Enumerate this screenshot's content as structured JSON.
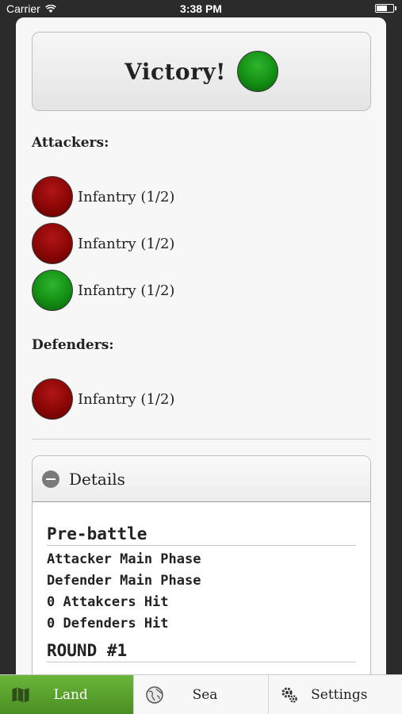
{
  "status_bar": {
    "carrier": "Carrier",
    "time": "3:38 PM"
  },
  "result": {
    "label": "Victory!",
    "indicator_color": "green"
  },
  "attackers": {
    "label": "Attackers:",
    "units": [
      {
        "name": "Infantry (1/2)",
        "status": "red"
      },
      {
        "name": "Infantry (1/2)",
        "status": "red"
      },
      {
        "name": "Infantry (1/2)",
        "status": "green"
      }
    ]
  },
  "defenders": {
    "label": "Defenders:",
    "units": [
      {
        "name": "Infantry (1/2)",
        "status": "red"
      }
    ]
  },
  "details": {
    "title": "Details",
    "pre_battle_heading": "Pre-battle",
    "lines": [
      "Attacker Main Phase",
      "Defender Main Phase",
      "0 Attakcers Hit",
      "0 Defenders Hit"
    ],
    "round_heading": "ROUND #1"
  },
  "tabs": [
    {
      "label": "Land",
      "icon": "map-icon",
      "active": true
    },
    {
      "label": "Sea",
      "icon": "globe-icon",
      "active": false
    },
    {
      "label": "Settings",
      "icon": "gears-icon",
      "active": false
    }
  ],
  "colors": {
    "red": "#8a0606",
    "green": "#138f13",
    "active_tab": "#5aa02f"
  }
}
